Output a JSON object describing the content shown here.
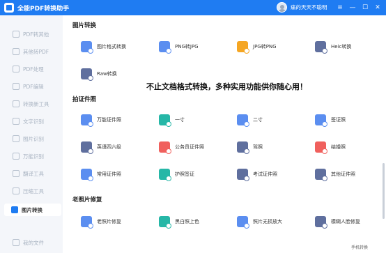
{
  "app": {
    "title": "全能PDF转换助手",
    "username": "痛的天天不聪明",
    "controls": {
      "menu": "≡",
      "minimize": "—",
      "maximize": "☐",
      "close": "✕"
    }
  },
  "sidebar": {
    "items": [
      {
        "label": "PDF转其他",
        "icon": "pdf-export-icon"
      },
      {
        "label": "其他转PDF",
        "icon": "pdf-import-icon"
      },
      {
        "label": "PDF处理",
        "icon": "pdf-tools-icon"
      },
      {
        "label": "PDF编辑",
        "icon": "pdf-edit-icon"
      },
      {
        "label": "转换新工具",
        "icon": "new-tools-icon"
      },
      {
        "label": "文字识别",
        "icon": "ocr-icon"
      },
      {
        "label": "图片识别",
        "icon": "image-ocr-icon"
      },
      {
        "label": "万能识别",
        "icon": "universal-ocr-icon"
      },
      {
        "label": "翻译工具",
        "icon": "translate-icon"
      },
      {
        "label": "压缩工具",
        "icon": "compress-icon"
      },
      {
        "label": "图片转换",
        "icon": "image-convert-icon"
      },
      {
        "label": "我的文件",
        "icon": "my-files-icon"
      }
    ],
    "active": "图片转换"
  },
  "sections": [
    {
      "title": "图片转换",
      "tiles": [
        {
          "label": "图片格式转换",
          "color": "#5b8ef0"
        },
        {
          "label": "PNG转JPG",
          "color": "#5b8ef0"
        },
        {
          "label": "JPG转PNG",
          "color": "#f5a623"
        },
        {
          "label": "Heic转换",
          "color": "#5f6f9e"
        },
        {
          "label": "Raw转换",
          "color": "#5f6f9e"
        }
      ]
    },
    {
      "title": "拍证件照",
      "tiles": [
        {
          "label": "万能证件照",
          "color": "#5b8ef0"
        },
        {
          "label": "一寸",
          "color": "#26b7a7"
        },
        {
          "label": "二寸",
          "color": "#5b8ef0"
        },
        {
          "label": "签证照",
          "color": "#5b8ef0"
        },
        {
          "label": "英语四六级",
          "color": "#5f6f9e"
        },
        {
          "label": "公务员证件照",
          "color": "#f0605d"
        },
        {
          "label": "驾照",
          "color": "#5f6f9e"
        },
        {
          "label": "结婚照",
          "color": "#f0605d"
        },
        {
          "label": "常用证件照",
          "color": "#5b8ef0"
        },
        {
          "label": "护照签证",
          "color": "#26b7a7"
        },
        {
          "label": "考试证件照",
          "color": "#5f6f9e"
        },
        {
          "label": "其他证件照",
          "color": "#5f6f9e"
        }
      ]
    },
    {
      "title": "老照片修复",
      "tiles": [
        {
          "label": "老照片修复",
          "color": "#5b8ef0"
        },
        {
          "label": "黑白照上色",
          "color": "#26b7a7"
        },
        {
          "label": "照片无损放大",
          "color": "#5b8ef0"
        },
        {
          "label": "模糊人脸修复",
          "color": "#5f6f9e"
        }
      ]
    }
  ],
  "banner": "不止文档格式转换，多种实用功能供你随心用！",
  "footer": "手机转换"
}
